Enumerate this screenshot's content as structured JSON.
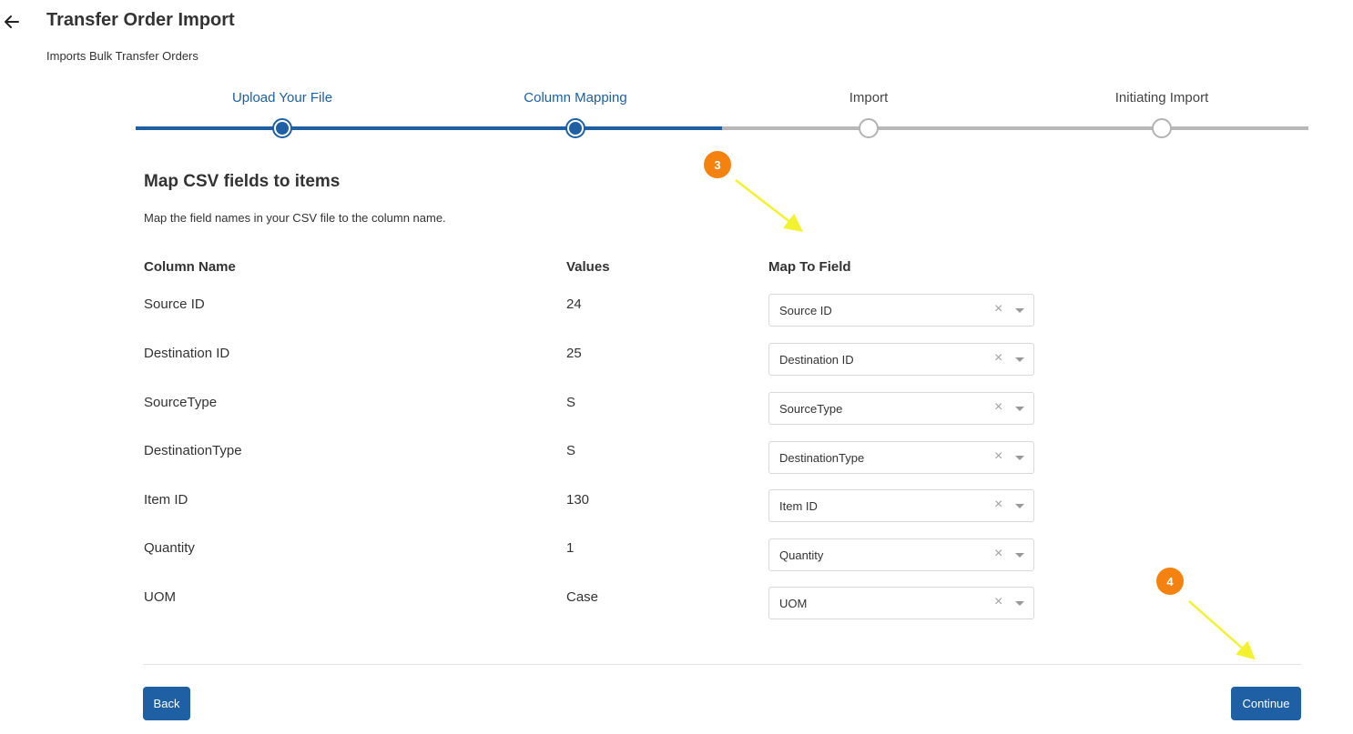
{
  "header": {
    "back_icon": "arrow-left-icon",
    "title": "Transfer Order Import",
    "subtitle": "Imports Bulk Transfer Orders"
  },
  "stepper": {
    "steps": [
      {
        "label": "Upload Your File",
        "state": "completed"
      },
      {
        "label": "Column Mapping",
        "state": "current"
      },
      {
        "label": "Import",
        "state": "pending"
      },
      {
        "label": "Initiating Import",
        "state": "pending"
      }
    ],
    "active_color": "#1f5fa3",
    "inactive_color": "#b8b8b8"
  },
  "mapping": {
    "title": "Map CSV fields to items",
    "description": "Map the field names in your CSV file to the column name.",
    "headers": {
      "column_name": "Column Name",
      "values": "Values",
      "map_to_field": "Map To Field"
    },
    "rows": [
      {
        "column": "Source ID",
        "value": "24",
        "mapped": "Source ID"
      },
      {
        "column": "Destination ID",
        "value": "25",
        "mapped": "Destination ID"
      },
      {
        "column": "SourceType",
        "value": "S",
        "mapped": "SourceType"
      },
      {
        "column": "DestinationType",
        "value": "S",
        "mapped": "DestinationType"
      },
      {
        "column": "Item ID",
        "value": "130",
        "mapped": "Item ID"
      },
      {
        "column": "Quantity",
        "value": "1",
        "mapped": "Quantity"
      },
      {
        "column": "UOM",
        "value": "Case",
        "mapped": "UOM"
      }
    ],
    "clear_symbol": "×"
  },
  "footer": {
    "back_label": "Back",
    "continue_label": "Continue",
    "button_color": "#1f5fa3"
  },
  "annotations": {
    "badge_3": "3",
    "badge_4": "4",
    "badge_color": "#f5820f",
    "arrow_color": "#f2f22e"
  }
}
